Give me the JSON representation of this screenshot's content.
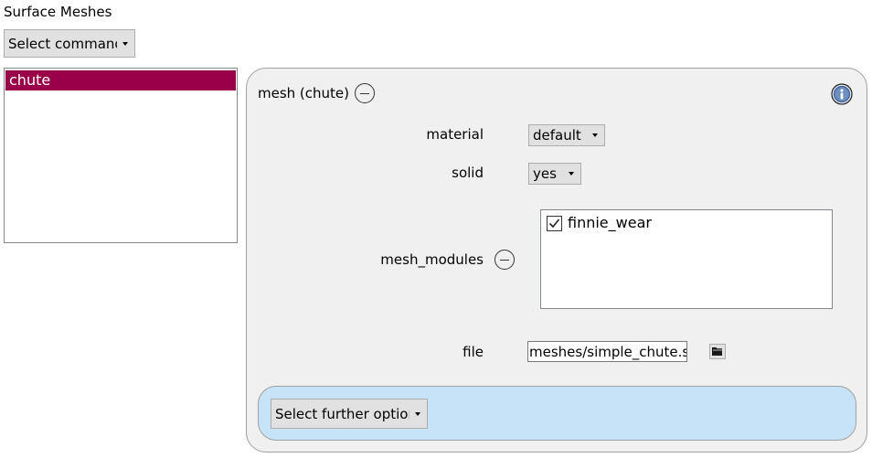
{
  "page": {
    "title": "Surface Meshes"
  },
  "command_select": {
    "label": "Select command"
  },
  "mesh_list": {
    "items": [
      {
        "label": "chute",
        "selected": true
      }
    ],
    "selected_color": "#990049"
  },
  "mesh_panel": {
    "title": "mesh (chute)",
    "fields": {
      "material": {
        "label": "material",
        "value": "default"
      },
      "solid": {
        "label": "solid",
        "value": "yes"
      },
      "mesh_modules": {
        "label": "mesh_modules",
        "items": [
          {
            "label": "finnie_wear",
            "checked": true
          }
        ]
      },
      "file": {
        "label": "file",
        "value": "meshes/simple_chute.stl"
      }
    },
    "further_option": {
      "label": "Select further option",
      "background": "#c6e3f7"
    },
    "icons": {
      "collapse": "minus-circle-icon",
      "info": "info-icon",
      "folder": "folder-icon"
    }
  }
}
